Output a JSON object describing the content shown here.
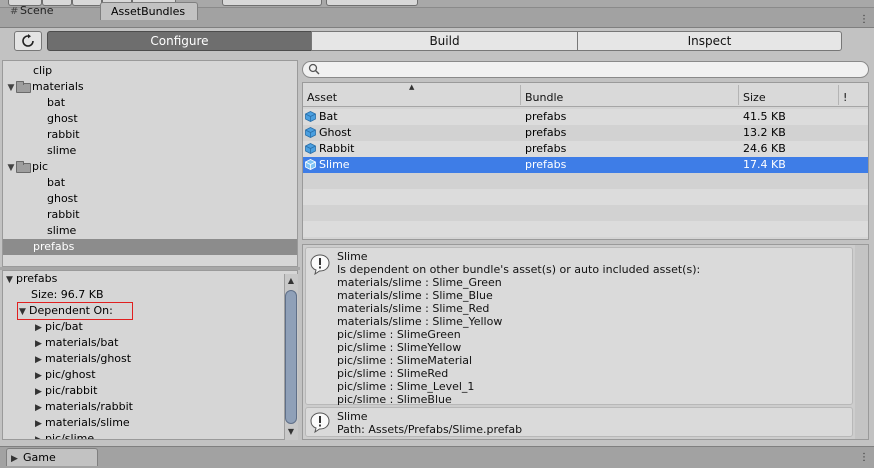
{
  "tabs": [
    {
      "label": "Scene",
      "icon": "grid-icon"
    },
    {
      "label": "AssetBundles"
    }
  ],
  "toolbar": {
    "refresh_icon": "refresh-icon",
    "segments": [
      "Configure",
      "Build",
      "Inspect"
    ],
    "active_segment": "Configure"
  },
  "tree": {
    "items": [
      {
        "label": "clip"
      },
      {
        "label": "materials",
        "folder": true
      },
      {
        "label": "bat"
      },
      {
        "label": "ghost"
      },
      {
        "label": "rabbit"
      },
      {
        "label": "slime"
      },
      {
        "label": "pic",
        "folder": true
      },
      {
        "label": "bat"
      },
      {
        "label": "ghost"
      },
      {
        "label": "rabbit"
      },
      {
        "label": "slime"
      },
      {
        "label": "prefabs",
        "selected": true
      }
    ]
  },
  "bundle_detail": {
    "name": "prefabs",
    "size": "Size: 96.7 KB",
    "dependent_on_label": "Dependent On:",
    "dependencies": [
      "pic/bat",
      "materials/bat",
      "materials/ghost",
      "pic/ghost",
      "pic/rabbit",
      "materials/rabbit",
      "materials/slime",
      "pic/slime"
    ]
  },
  "search": {
    "placeholder": ""
  },
  "asset_table": {
    "columns": [
      "Asset",
      "Bundle",
      "Size",
      "!"
    ],
    "rows": [
      {
        "asset": "Bat",
        "bundle": "prefabs",
        "size": "41.5 KB"
      },
      {
        "asset": "Ghost",
        "bundle": "prefabs",
        "size": "13.2 KB"
      },
      {
        "asset": "Rabbit",
        "bundle": "prefabs",
        "size": "24.6 KB"
      },
      {
        "asset": "Slime",
        "bundle": "prefabs",
        "size": "17.4 KB",
        "selected": true
      }
    ]
  },
  "messages": {
    "dependency": {
      "title": "Slime",
      "lines": [
        "Is dependent on other bundle's asset(s) or auto included asset(s):",
        "materials/slime : Slime_Green",
        "materials/slime : Slime_Blue",
        "materials/slime : Slime_Red",
        "materials/slime : Slime_Yellow",
        "pic/slime : SlimeGreen",
        "pic/slime : SlimeYellow",
        "pic/slime : SlimeMaterial",
        "pic/slime : SlimeRed",
        "pic/slime : Slime_Level_1",
        "pic/slime : SlimeBlue"
      ]
    },
    "path": {
      "title": "Slime",
      "line": "Path: Assets/Prefabs/Slime.prefab"
    }
  },
  "bottom_tabs": [
    {
      "label": "Game",
      "icon": "game-icon"
    }
  ],
  "colors": {
    "selection": "#3e7de7",
    "tree_selection": "#8c8c8c",
    "highlight_box": "#e02020"
  }
}
